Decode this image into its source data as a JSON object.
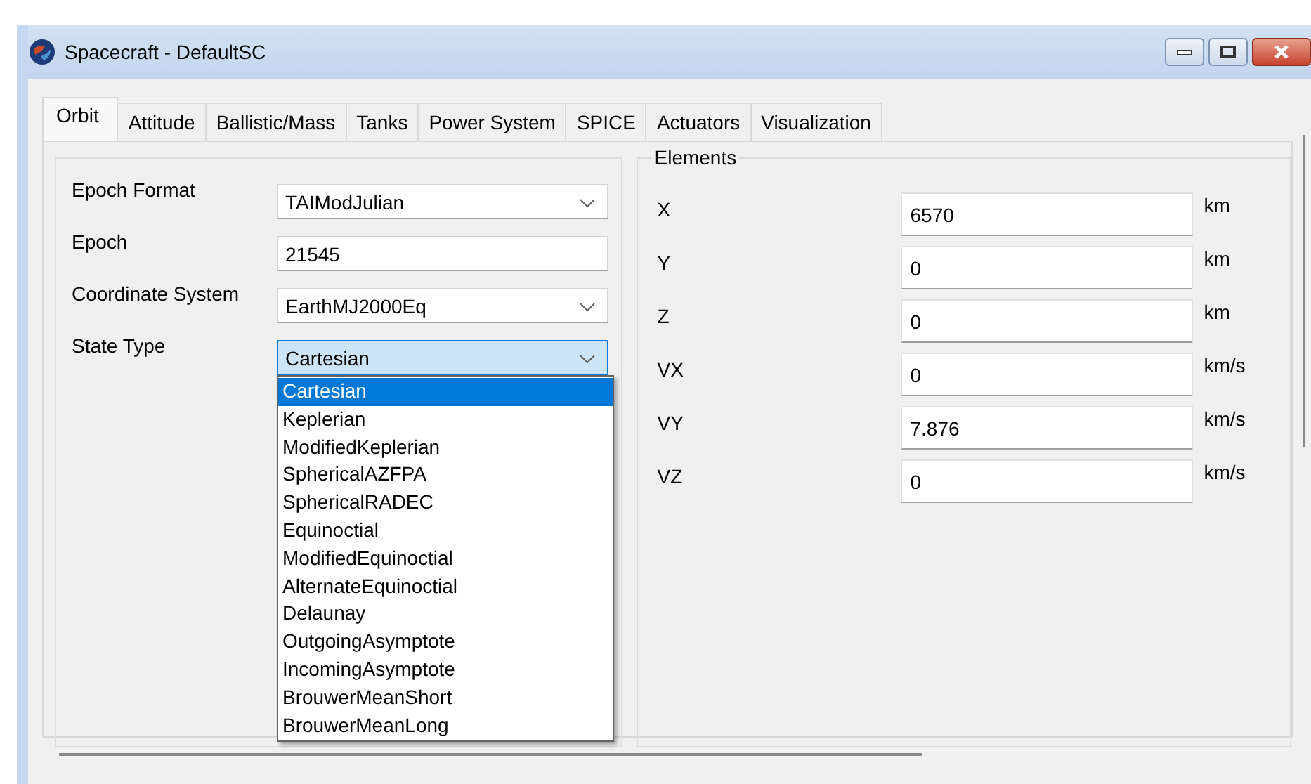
{
  "window": {
    "title": "Spacecraft - DefaultSC"
  },
  "tabs": [
    {
      "label": "Orbit",
      "selected": true
    },
    {
      "label": "Attitude",
      "selected": false
    },
    {
      "label": "Ballistic/Mass",
      "selected": false
    },
    {
      "label": "Tanks",
      "selected": false
    },
    {
      "label": "Power System",
      "selected": false
    },
    {
      "label": "SPICE",
      "selected": false
    },
    {
      "label": "Actuators",
      "selected": false
    },
    {
      "label": "Visualization",
      "selected": false
    }
  ],
  "orbit_fields": [
    {
      "label": "Epoch Format",
      "kind": "combo",
      "value": "TAIModJulian",
      "expanded": false
    },
    {
      "label": "Epoch",
      "kind": "text",
      "value": "21545"
    },
    {
      "label": "Coordinate System",
      "kind": "combo",
      "value": "EarthMJ2000Eq",
      "expanded": false
    },
    {
      "label": "State Type",
      "kind": "combo",
      "value": "Cartesian",
      "expanded": true,
      "options": [
        {
          "label": "Cartesian",
          "selected": true
        },
        {
          "label": "Keplerian",
          "selected": false
        },
        {
          "label": "ModifiedKeplerian",
          "selected": false
        },
        {
          "label": "SphericalAZFPA",
          "selected": false
        },
        {
          "label": "SphericalRADEC",
          "selected": false
        },
        {
          "label": "Equinoctial",
          "selected": false
        },
        {
          "label": "ModifiedEquinoctial",
          "selected": false
        },
        {
          "label": "AlternateEquinoctial",
          "selected": false
        },
        {
          "label": "Delaunay",
          "selected": false
        },
        {
          "label": "OutgoingAsymptote",
          "selected": false
        },
        {
          "label": "IncomingAsymptote",
          "selected": false
        },
        {
          "label": "BrouwerMeanShort",
          "selected": false
        },
        {
          "label": "BrouwerMeanLong",
          "selected": false
        }
      ]
    }
  ],
  "elements": {
    "title": "Elements",
    "rows": [
      {
        "label": "X",
        "value": "6570",
        "unit": "km"
      },
      {
        "label": "Y",
        "value": "0",
        "unit": "km"
      },
      {
        "label": "Z",
        "value": "0",
        "unit": "km"
      },
      {
        "label": "VX",
        "value": "0",
        "unit": "km/s"
      },
      {
        "label": "VY",
        "value": "7.876",
        "unit": "km/s"
      },
      {
        "label": "VZ",
        "value": "0",
        "unit": "km/s"
      }
    ]
  }
}
